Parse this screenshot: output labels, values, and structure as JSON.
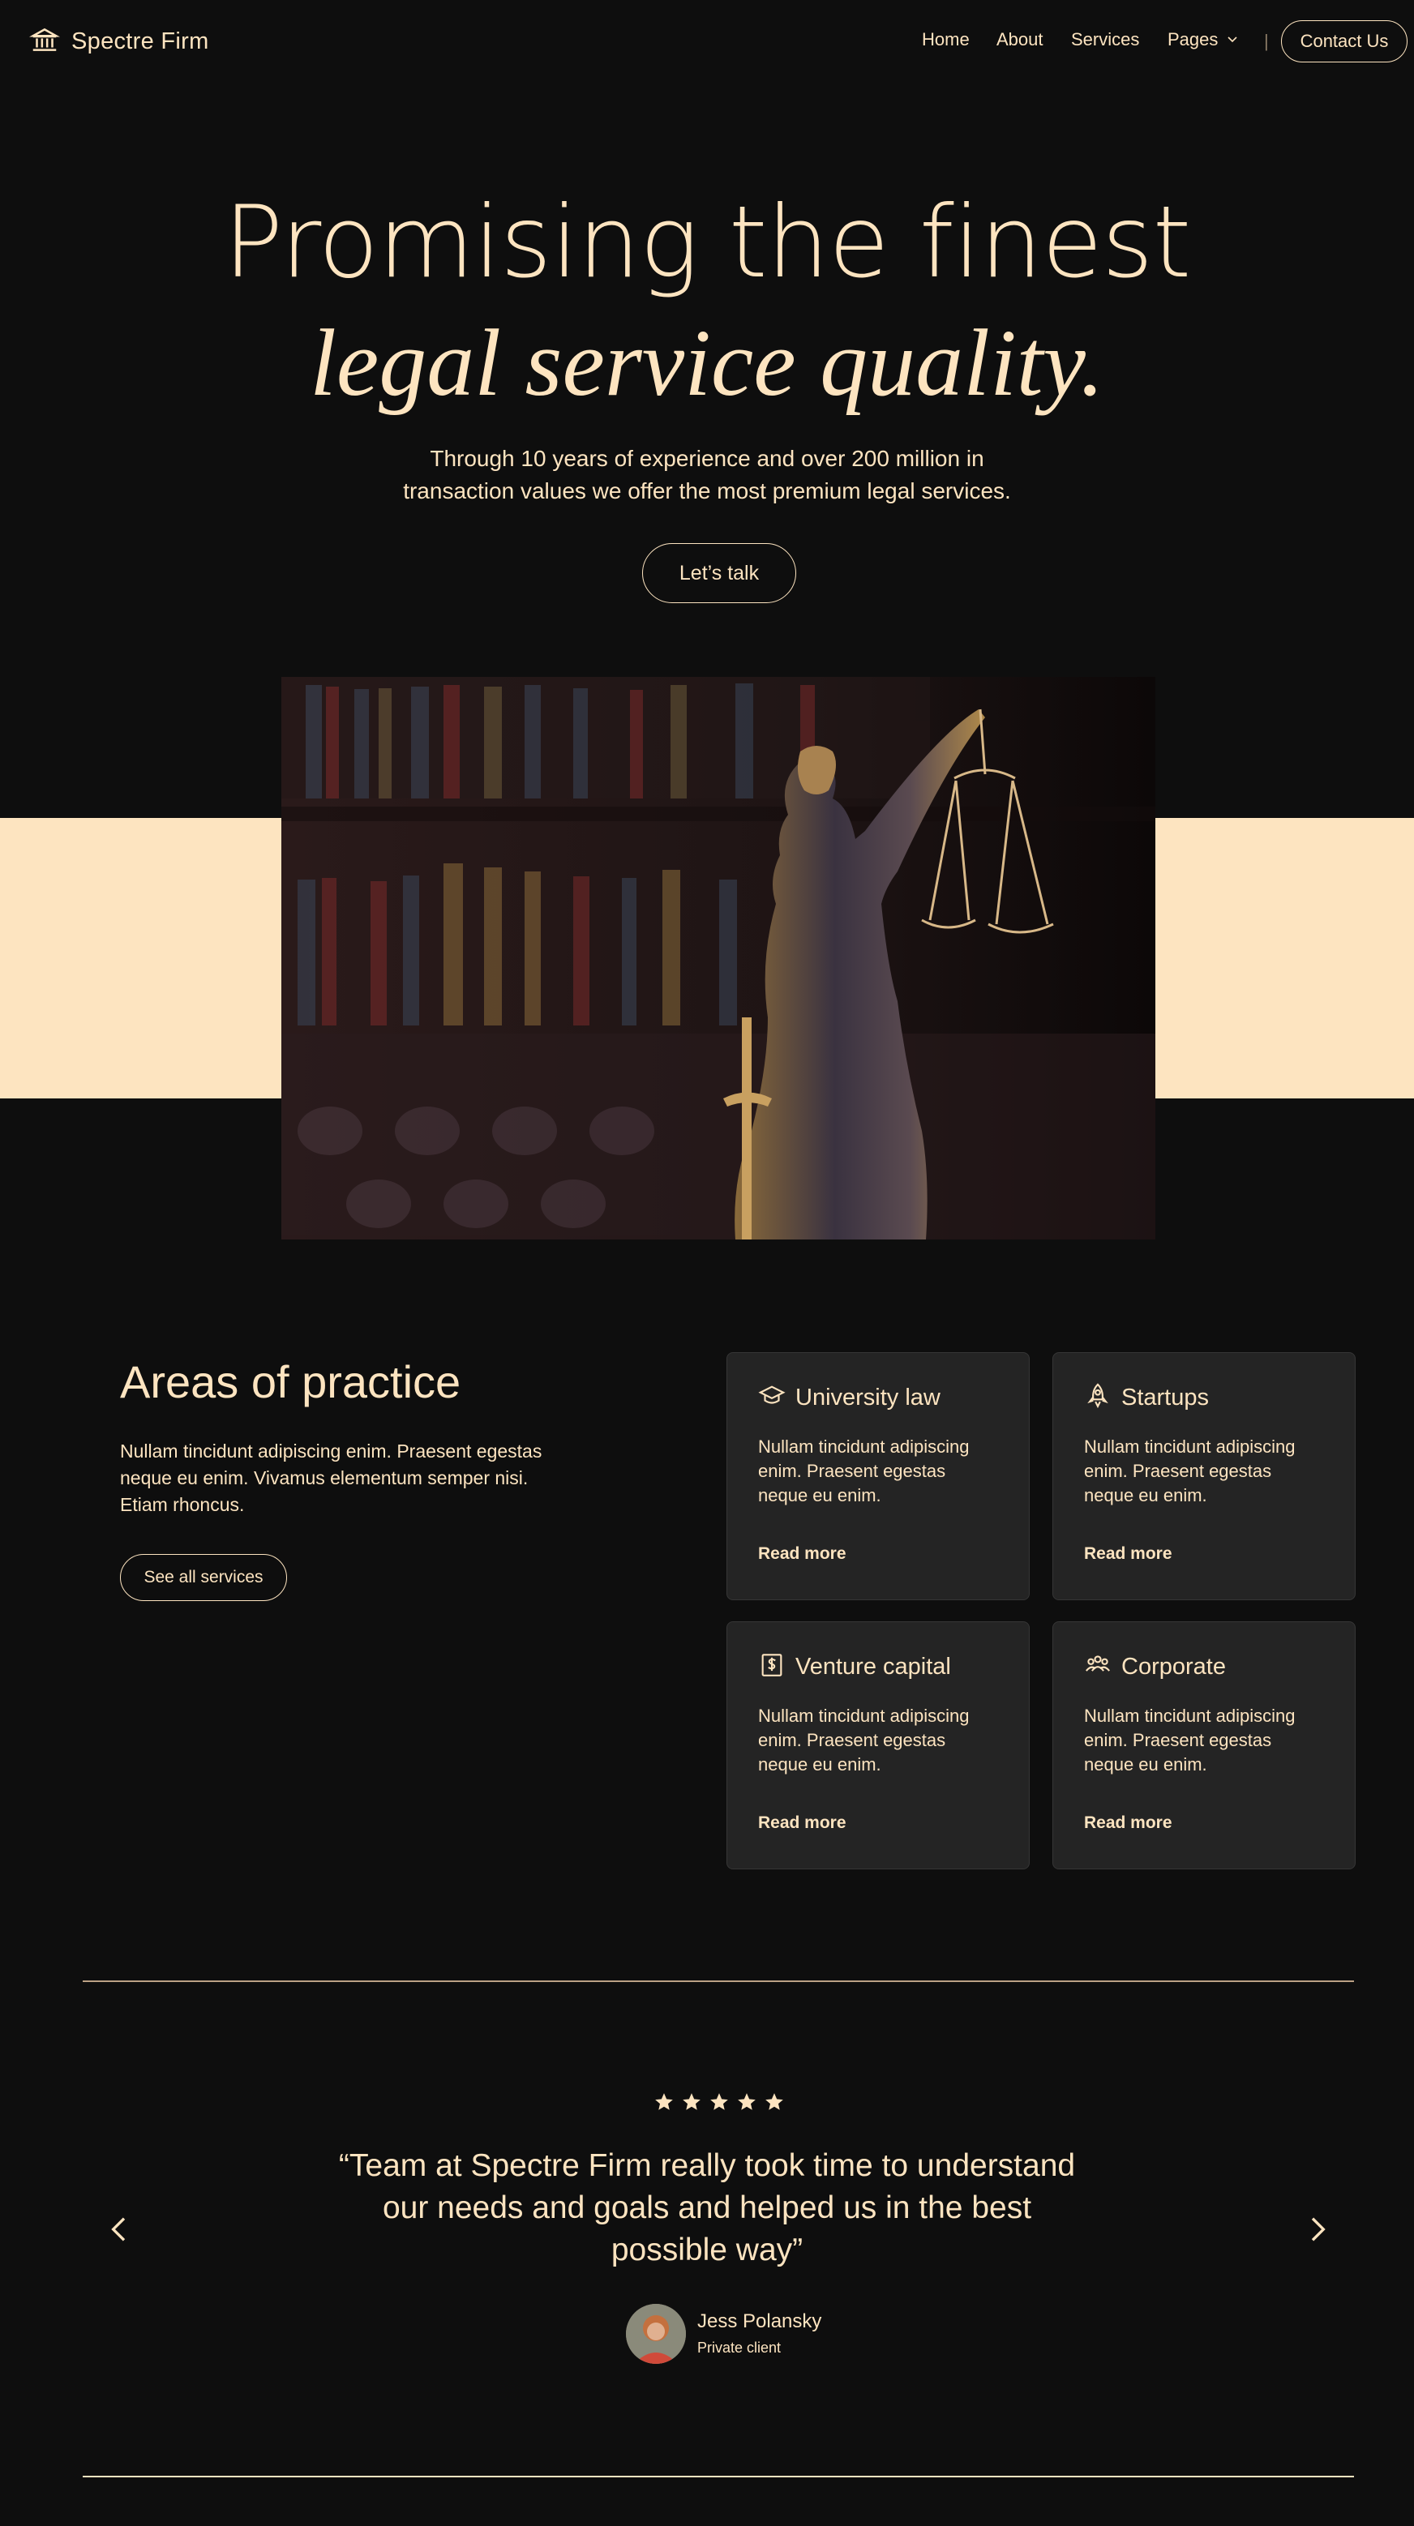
{
  "nav": {
    "brand": "Spectre Firm",
    "items": [
      {
        "label": "Home"
      },
      {
        "label": "About"
      },
      {
        "label": "Services"
      },
      {
        "label": "Pages"
      }
    ],
    "separator": "|",
    "contact_label": "Contact Us"
  },
  "hero": {
    "title_line1": "Promising the finest",
    "title_line2": "legal service quality.",
    "subtitle_line1": "Through 10 years of experience and over 200 million in",
    "subtitle_line2": "transaction values we offer the most premium legal services.",
    "cta_label": "Let’s talk"
  },
  "areas": {
    "title": "Areas of practice",
    "description": "Nullam tincidunt adipiscing enim. Praesent egestas neque eu enim. Vivamus elementum semper nisi. Etiam rhoncus.",
    "button_label": "See all services",
    "cards": [
      {
        "title": "University law",
        "text": "Nullam tincidunt adipiscing enim. Praesent egestas neque eu enim.",
        "link": "Read more",
        "icon": "graduation-cap-icon"
      },
      {
        "title": "Startups",
        "text": "Nullam tincidunt adipiscing enim. Praesent egestas neque eu enim.",
        "link": "Read more",
        "icon": "rocket-icon"
      },
      {
        "title": "Venture capital",
        "text": "Nullam tincidunt adipiscing enim. Praesent egestas neque eu enim.",
        "link": "Read more",
        "icon": "dollar-icon"
      },
      {
        "title": "Corporate",
        "text": "Nullam tincidunt adipiscing enim. Praesent egestas neque eu enim.",
        "link": "Read more",
        "icon": "users-icon"
      }
    ]
  },
  "testimonial": {
    "rating": 5,
    "quote_line1": "“Team at Spectre Firm really took time to understand",
    "quote_line2": "our needs and goals and helped us in the best",
    "quote_line3": "possible way”",
    "author_name": "Jess Polansky",
    "author_role": "Private client"
  },
  "colors": {
    "background": "#0e0e0e",
    "accent": "#fde4c0",
    "card": "#242424"
  }
}
